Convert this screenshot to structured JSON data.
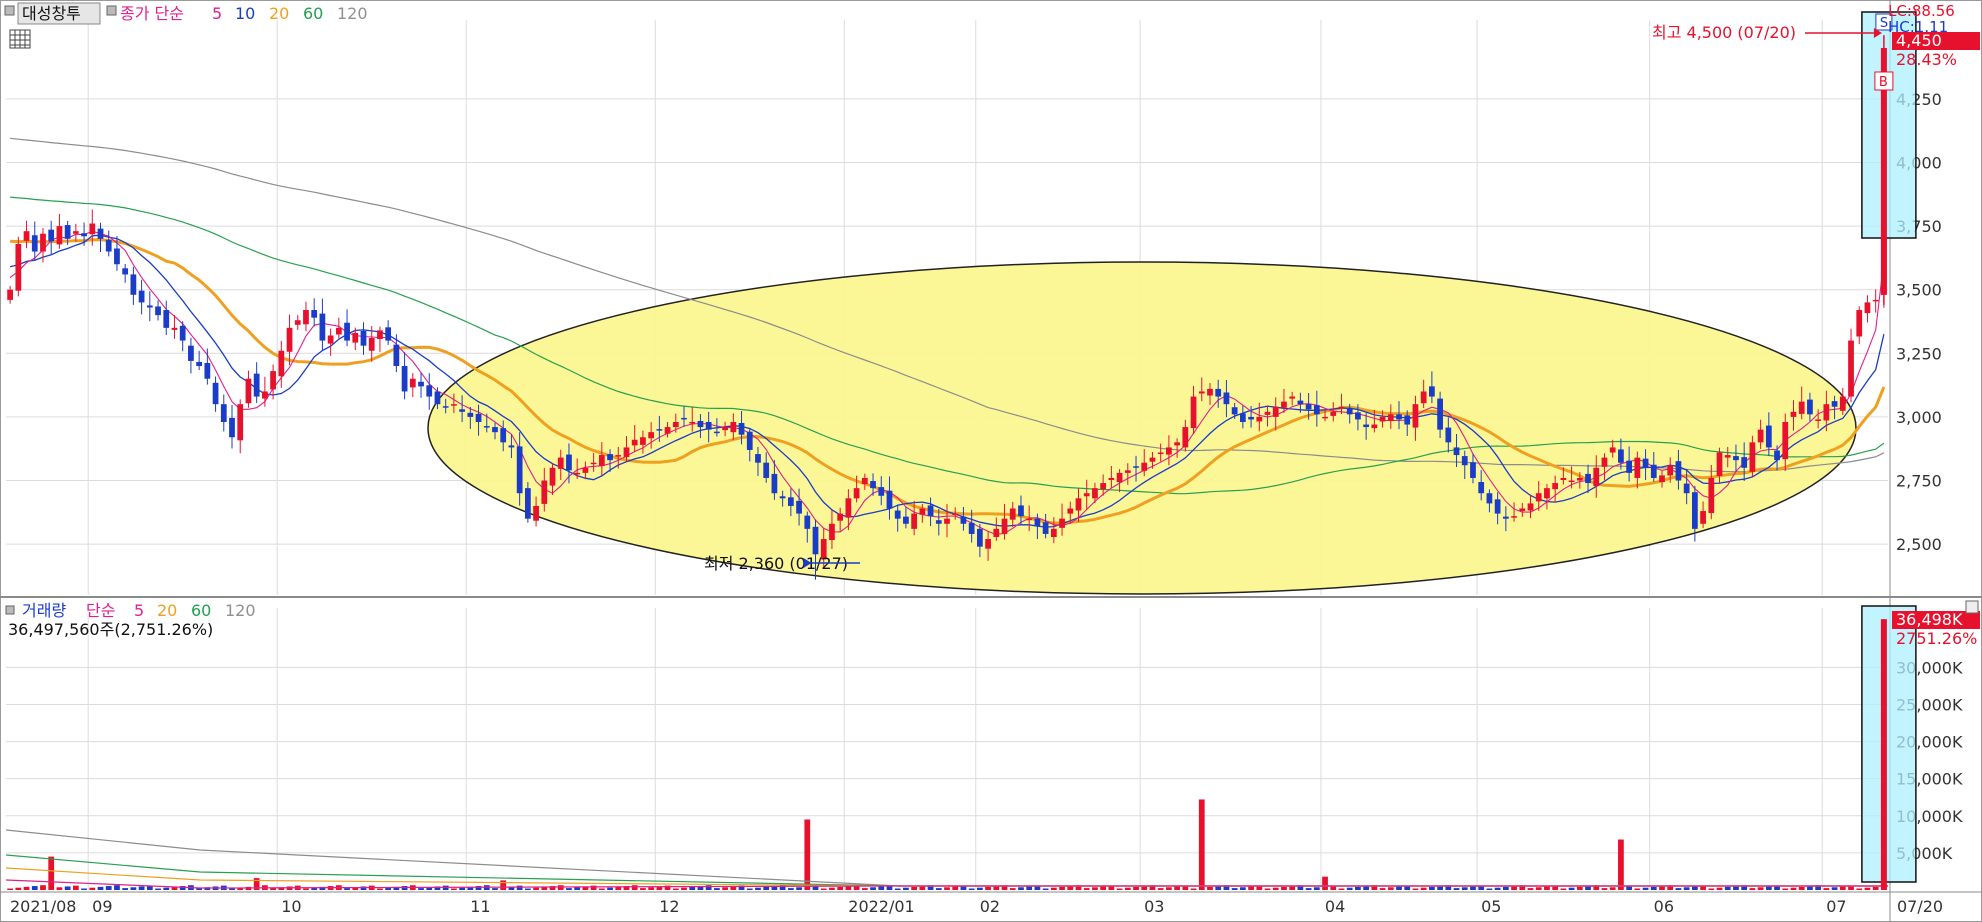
{
  "price_legend": {
    "instrument": "대성창투",
    "ma_label": "종가 단순",
    "periods": [
      "5",
      "10",
      "20",
      "60",
      "120"
    ],
    "colors": [
      "#e0208c",
      "#1a3cc8",
      "#f0a020",
      "#20a050",
      "#909090"
    ]
  },
  "volume_legend": {
    "title": "거래량",
    "ma_label": "단순",
    "periods": [
      "5",
      "20",
      "60",
      "120"
    ],
    "value_text": "36,497,560주(2,751.26%)"
  },
  "right_labels": {
    "lc": "LC:88.56",
    "hc": "HC:1.11",
    "last_price": "4,450",
    "last_change": "28.43%",
    "last_volume": "36,498K",
    "last_volume_change": "2751.26%"
  },
  "annotations": {
    "high": "최고 4,500 (07/20)",
    "low": "최저 2,360 (01/27)",
    "sell_marker": "S",
    "buy_marker": "B"
  },
  "x_axis_labels": [
    "2021/08",
    "09",
    "10",
    "11",
    "12",
    "2022/01",
    "02",
    "03",
    "04",
    "05",
    "06",
    "07",
    "07/20"
  ],
  "chart_data": [
    {
      "type": "candlestick",
      "ylim": [
        2300,
        4560
      ],
      "y_ticks": [
        2500,
        2750,
        3000,
        3250,
        3500,
        3750,
        4000,
        4250
      ],
      "y_tick_labels": [
        "2,500",
        "2,750",
        "3,000",
        "3,250",
        "3,500",
        "3,750",
        "4,000",
        "4,250"
      ],
      "close": [
        3500,
        3680,
        3730,
        3650,
        3720,
        3690,
        3750,
        3700,
        3730,
        3710,
        3760,
        3700,
        3650,
        3600,
        3560,
        3480,
        3450,
        3430,
        3400,
        3350,
        3350,
        3300,
        3220,
        3200,
        3150,
        3050,
        2980,
        2920,
        3050,
        3150,
        3080,
        3100,
        3180,
        3260,
        3350,
        3380,
        3420,
        3390,
        3300,
        3320,
        3350,
        3300,
        3330,
        3280,
        3310,
        3340,
        3300,
        3200,
        3100,
        3150,
        3120,
        3080,
        3050,
        3040,
        3050,
        3020,
        3000,
        2980,
        2960,
        2940,
        2900,
        2880,
        2700,
        2600,
        2650,
        2750,
        2800,
        2840,
        2790,
        2780,
        2800,
        2820,
        2850,
        2830,
        2850,
        2880,
        2910,
        2920,
        2940,
        2950,
        2960,
        2980,
        2990,
        2980,
        2960,
        2950,
        2940,
        2960,
        2980,
        2930,
        2870,
        2820,
        2760,
        2700,
        2680,
        2650,
        2620,
        2560,
        2460,
        2520,
        2580,
        2620,
        2680,
        2720,
        2760,
        2720,
        2690,
        2640,
        2600,
        2580,
        2620,
        2640,
        2610,
        2580,
        2600,
        2620,
        2580,
        2540,
        2490,
        2520,
        2560,
        2600,
        2640,
        2610,
        2600,
        2570,
        2540,
        2560,
        2600,
        2640,
        2680,
        2700,
        2720,
        2740,
        2760,
        2780,
        2790,
        2800,
        2820,
        2840,
        2860,
        2880,
        2900,
        2960,
        3080,
        3100,
        3110,
        3080,
        3050,
        3010,
        2980,
        2990,
        3000,
        3020,
        3040,
        3060,
        3080,
        3050,
        3030,
        3010,
        3000,
        3020,
        3040,
        3010,
        2990,
        2960,
        2970,
        3000,
        3010,
        2990,
        2970,
        3050,
        3100,
        3080,
        2950,
        2900,
        2850,
        2810,
        2760,
        2700,
        2660,
        2620,
        2600,
        2610,
        2640,
        2660,
        2700,
        2720,
        2740,
        2760,
        2750,
        2760,
        2740,
        2800,
        2840,
        2880,
        2820,
        2780,
        2840,
        2800,
        2760,
        2770,
        2810,
        2750,
        2700,
        2560,
        2630,
        2760,
        2860,
        2850,
        2830,
        2800,
        2900,
        2950,
        2880,
        2830,
        2980,
        3020,
        3060,
        3010,
        2990,
        3050,
        3040,
        3080,
        3300,
        3420,
        3450,
        3460,
        4450
      ],
      "high_value": 4500,
      "low_value": 2360
    },
    {
      "type": "bar",
      "name": "volume",
      "ylim": [
        0,
        38000
      ],
      "y_ticks": [
        5000,
        10000,
        15000,
        20000,
        25000,
        30000
      ],
      "y_tick_labels": [
        "5,000K",
        "10,000K",
        "15,000K",
        "20,000K",
        "25,000K",
        "30,000K"
      ],
      "spikes": [
        {
          "index": 5,
          "value": 4500
        },
        {
          "index": 30,
          "value": 1600
        },
        {
          "index": 60,
          "value": 1300
        },
        {
          "index": 97,
          "value": 9500
        },
        {
          "index": 145,
          "value": 12200
        },
        {
          "index": 160,
          "value": 1800
        },
        {
          "index": 196,
          "value": 6800
        },
        {
          "index": 240,
          "value": 36498
        }
      ],
      "base_value": 500
    }
  ]
}
